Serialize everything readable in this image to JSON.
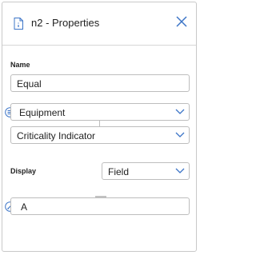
{
  "header": {
    "title": "n2 - Properties",
    "doc_icon": "document-icon",
    "close_icon": "close-icon"
  },
  "name_section": {
    "label": "Name",
    "value": "Equal"
  },
  "entity_select": {
    "value": "Equipment",
    "icon": "list-circle-icon"
  },
  "field_select": {
    "value": "Criticality Indicator"
  },
  "display_section": {
    "label": "Display",
    "value": "Field"
  },
  "operator": {
    "icon": "equals-icon"
  },
  "value_input": {
    "value": "A",
    "icon": "pencil-circle-icon"
  },
  "colors": {
    "accent": "#3b74c7",
    "border": "#bdbdbd"
  }
}
